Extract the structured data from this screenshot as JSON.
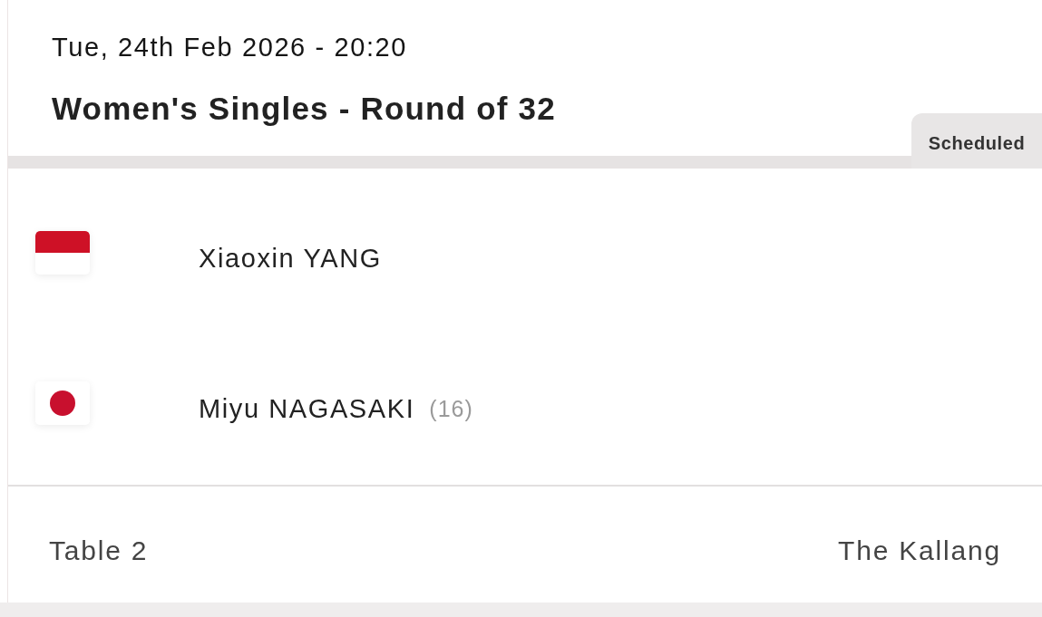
{
  "match": {
    "datetime": "Tue, 24th Feb 2026 - 20:20",
    "title": "Women's Singles - Round of 32",
    "status": "Scheduled"
  },
  "players": [
    {
      "kind": "bands",
      "name": "Xiaoxin YANG"
    },
    {
      "kind": "disc",
      "name": "Miyu NAGASAKI",
      "seed": "(16)"
    }
  ],
  "footer": {
    "table": "Table 2",
    "venue": "The Kallang"
  }
}
